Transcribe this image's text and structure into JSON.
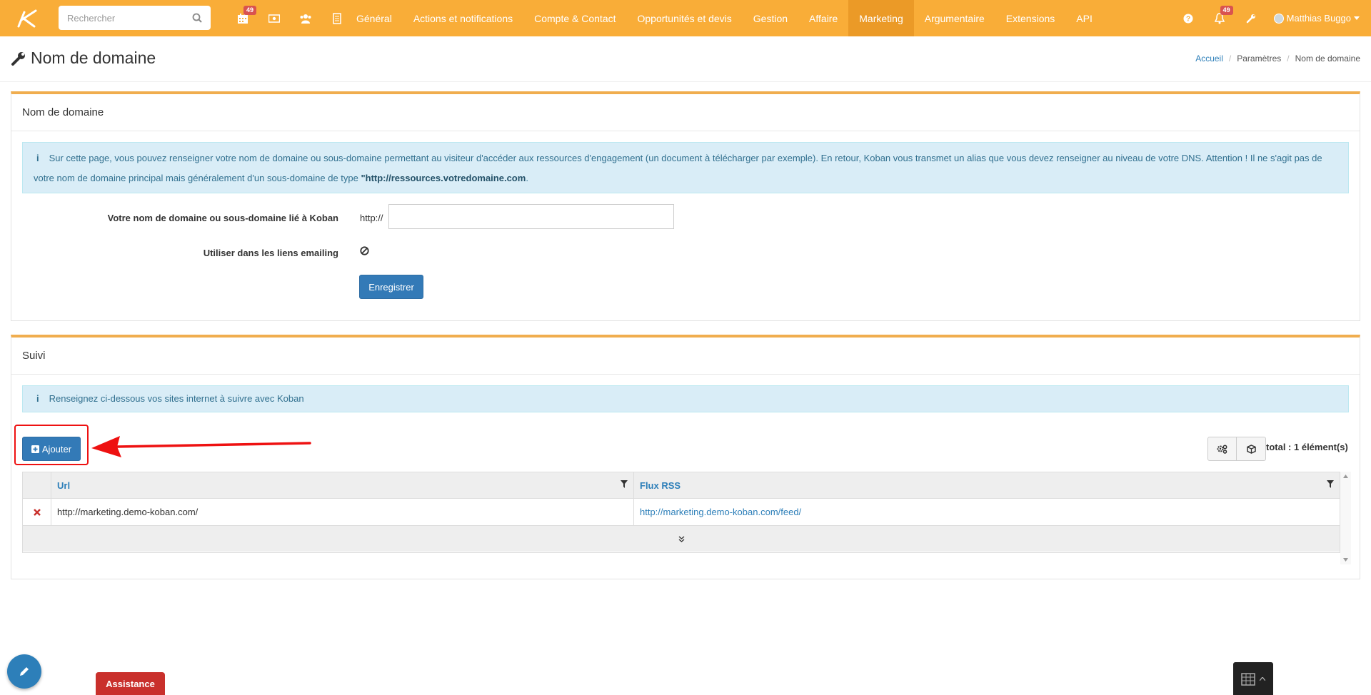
{
  "nav": {
    "search_placeholder": "Rechercher",
    "badge_calendar": "49",
    "badge_notifications": "49",
    "menu": [
      "Général",
      "Actions et notifications",
      "Compte & Contact",
      "Opportunités et devis",
      "Gestion",
      "Affaire",
      "Marketing",
      "Argumentaire",
      "Extensions",
      "API"
    ],
    "active_menu": "Marketing",
    "user_name": "Matthias Buggo"
  },
  "header": {
    "title": "Nom de domaine",
    "breadcrumb": [
      "Accueil",
      "Paramètres",
      "Nom de domaine"
    ]
  },
  "domain_panel": {
    "heading": "Nom de domaine",
    "alert_text_1": "Sur cette page, vous pouvez renseigner votre nom de domaine ou sous-domaine permettant au visiteur d'accéder aux ressources d'engagement (un document à télécharger par exemple). En retour, Koban vous transmet un alias que vous devez renseigner au niveau de votre DNS. Attention ! Il ne s'agit pas de",
    "alert_text_2": "votre nom de domaine principal mais généralement d'un sous-domaine de type ",
    "alert_bold": "\"http://ressources.votredomaine.com",
    "alert_end": ".",
    "domain_label": "Votre nom de domaine ou sous-domaine lié à Koban",
    "domain_prefix": "http://",
    "domain_value": "",
    "emailing_label": "Utiliser dans les liens emailing",
    "save_label": "Enregistrer"
  },
  "suivi_panel": {
    "heading": "Suivi",
    "alert_text": "Renseignez ci-dessous vos sites internet à suivre avec Koban",
    "add_label": "Ajouter",
    "total": "total : 1 élément(s)",
    "columns": [
      "Url",
      "Flux RSS"
    ],
    "rows": [
      {
        "url": "http://marketing.demo-koban.com/",
        "rss": "http://marketing.demo-koban.com/feed/"
      }
    ]
  },
  "footer": {
    "assistance_label": "Assistance"
  },
  "colors": {
    "navbar": "#f9ad38",
    "active_menu": "#eb9a27",
    "primary": "#337ab7",
    "annotation": "#ee1111"
  }
}
